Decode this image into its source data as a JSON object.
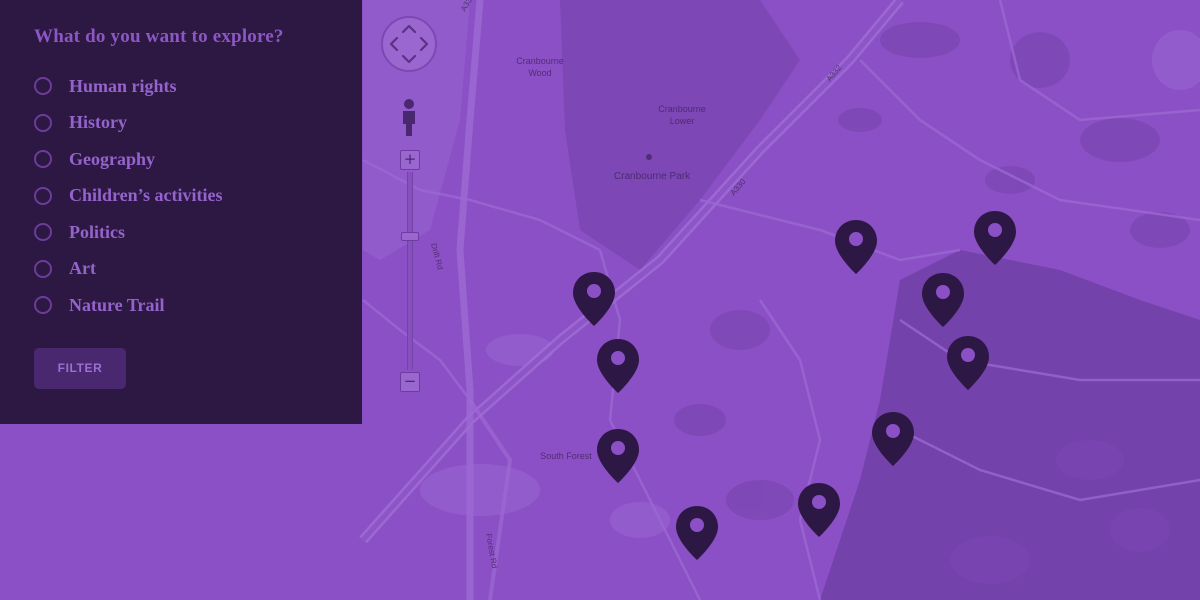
{
  "filter_panel": {
    "title": "What do you want to explore?",
    "options": [
      {
        "label": "Human rights",
        "selected": false
      },
      {
        "label": "History",
        "selected": false
      },
      {
        "label": "Geography",
        "selected": false
      },
      {
        "label": "Children’s activities",
        "selected": false
      },
      {
        "label": "Politics",
        "selected": false
      },
      {
        "label": "Art",
        "selected": false
      },
      {
        "label": "Nature Trail",
        "selected": false
      }
    ],
    "button_label": "FILTER"
  },
  "map": {
    "labels": {
      "cranbourne_wood": [
        "Cranbourne",
        "Wood"
      ],
      "cranbourne_lower": [
        "Cranbourne",
        "Lower"
      ],
      "cranbourne_park": "Cranbourne Park",
      "south_forest": "South Forest",
      "road_a330_top": "A330",
      "road_a330_mid": "A330",
      "road_a332": "A332",
      "road_drift_rd": "Drift Rd",
      "road_forest_rd": "Forest Rd"
    },
    "controls": {
      "zoom_in": "+",
      "zoom_out": "−"
    },
    "marker_count": 11
  },
  "colors": {
    "overlay": "#8b50c6",
    "panel": "#2c1843",
    "marker": "#2d1845",
    "accent": "#9563cc"
  },
  "icons": [
    "pan-control-icon",
    "pegman-icon",
    "map-marker-icon"
  ]
}
